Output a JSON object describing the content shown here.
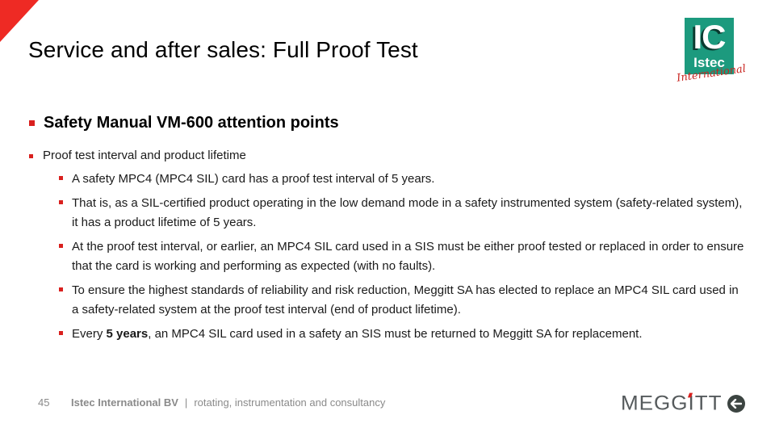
{
  "slide": {
    "title": "Service and after sales: Full Proof Test",
    "accent_color": "#ee2a24",
    "bullet_color": "#d9201e"
  },
  "logo": {
    "main": "IC",
    "sub": "Istec",
    "script": "International",
    "color": "#1c9a7e"
  },
  "content": {
    "heading": "Safety Manual VM-600 attention points",
    "level1": "Proof test interval and product lifetime",
    "level2": [
      {
        "text": "A safety MPC4 (MPC4 SIL) card has a proof test interval of 5 years."
      },
      {
        "text": "That is, as a SIL-certified product operating in the low demand mode in a safety instrumented system (safety-related system), it has a product lifetime of 5 years."
      },
      {
        "text": "At the proof test interval, or earlier, an MPC4 SIL card used in a SIS must be either proof tested or replaced in order to ensure that the card is working and performing as expected (with no faults)."
      },
      {
        "text": "To ensure the highest standards of reliability and risk reduction, Meggitt SA has elected to replace an MPC4 SIL card used in a safety-related system at the proof test interval (end of product lifetime)."
      },
      {
        "prefix": "Every ",
        "bold": "5 years",
        "suffix": ", an MPC4 SIL card used in a safety an SIS must be returned to Meggitt SA for replacement."
      }
    ]
  },
  "footer": {
    "page_number": "45",
    "company": "Istec International BV",
    "separator": "|",
    "tagline": "rotating, instrumentation and consultancy",
    "partner_logo": "MEGGiTT",
    "back_icon": "arrow-left-circle-icon"
  }
}
